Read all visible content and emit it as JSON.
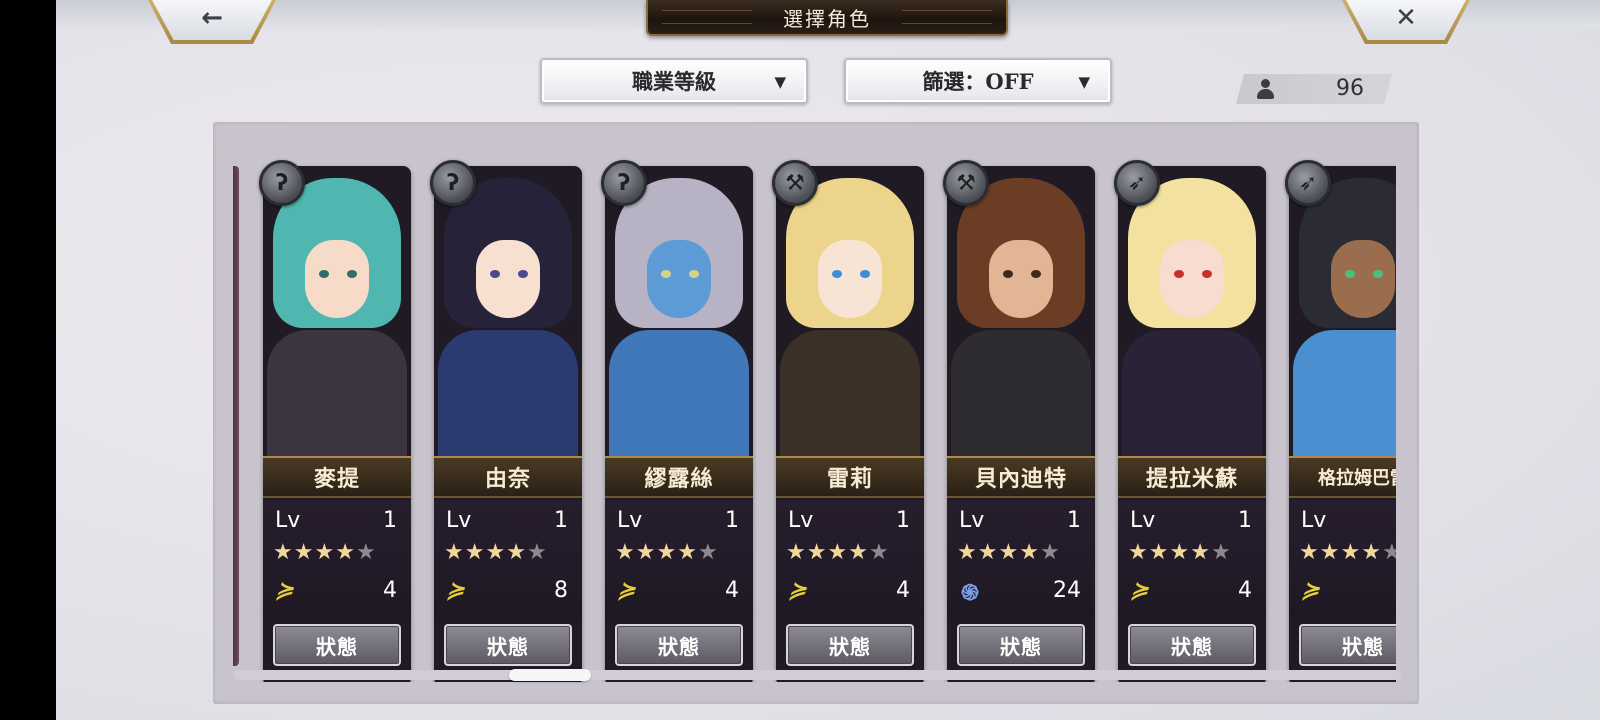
{
  "header": {
    "title": "選擇角色",
    "back_glyph": "←",
    "close_glyph": "✕"
  },
  "controls": {
    "sort_label": "職業等級",
    "filter_label": "篩選：OFF",
    "dropdown_arrow": "▼",
    "unit_count": "96"
  },
  "characters": [
    {
      "name": "麥提",
      "lv_label": "Lv",
      "level": "1",
      "stars": 4,
      "bonus_icon": "wing-icon",
      "bonus_value": "4",
      "status_label": "狀態",
      "weapon": "staff-icon",
      "hair": "#4fb7b0",
      "skin": "#f6dcc8",
      "outfit": "#3a3540",
      "eyes": "#2f6d6a"
    },
    {
      "name": "由奈",
      "lv_label": "Lv",
      "level": "1",
      "stars": 4,
      "bonus_icon": "wing-icon",
      "bonus_value": "8",
      "status_label": "狀態",
      "weapon": "staff-icon",
      "hair": "#26223a",
      "skin": "#f7e0d0",
      "outfit": "#2c3a72",
      "eyes": "#4a4a8a"
    },
    {
      "name": "繆露絲",
      "lv_label": "Lv",
      "level": "1",
      "stars": 4,
      "bonus_icon": "wing-icon",
      "bonus_value": "4",
      "status_label": "狀態",
      "weapon": "staff-icon",
      "hair": "#b7b2c4",
      "skin": "#5d9bd6",
      "outfit": "#3f77b8",
      "eyes": "#d7d28a"
    },
    {
      "name": "雷莉",
      "lv_label": "Lv",
      "level": "1",
      "stars": 4,
      "bonus_icon": "wing-icon",
      "bonus_value": "4",
      "status_label": "狀態",
      "weapon": "axe-icon",
      "hair": "#ecd58a",
      "skin": "#f8e4d4",
      "outfit": "#3b3028",
      "eyes": "#3a8fd8"
    },
    {
      "name": "貝內迪特",
      "lv_label": "Lv",
      "level": "1",
      "stars": 4,
      "bonus_icon": "swirl-icon",
      "bonus_value": "24",
      "status_label": "狀態",
      "weapon": "axe-icon",
      "hair": "#6a3d24",
      "skin": "#e2b594",
      "outfit": "#2e2c30",
      "eyes": "#3c2a20"
    },
    {
      "name": "提拉米蘇",
      "lv_label": "Lv",
      "level": "1",
      "stars": 4,
      "bonus_icon": "wing-icon",
      "bonus_value": "4",
      "status_label": "狀態",
      "weapon": "spear-icon",
      "hair": "#f3e1a0",
      "skin": "#f6ddd0",
      "outfit": "#2a2236",
      "eyes": "#c8302c"
    },
    {
      "name": "格拉姆巴雷",
      "lv_label": "Lv",
      "level": "",
      "stars": 4,
      "bonus_icon": "wing-icon",
      "bonus_value": "",
      "status_label": "狀態",
      "weapon": "spear-icon",
      "hair": "#2b2c33",
      "skin": "#9a6d4e",
      "outfit": "#4a8fcf",
      "eyes": "#4cc07a"
    }
  ],
  "stars_max": 5,
  "star_glyph": "★"
}
